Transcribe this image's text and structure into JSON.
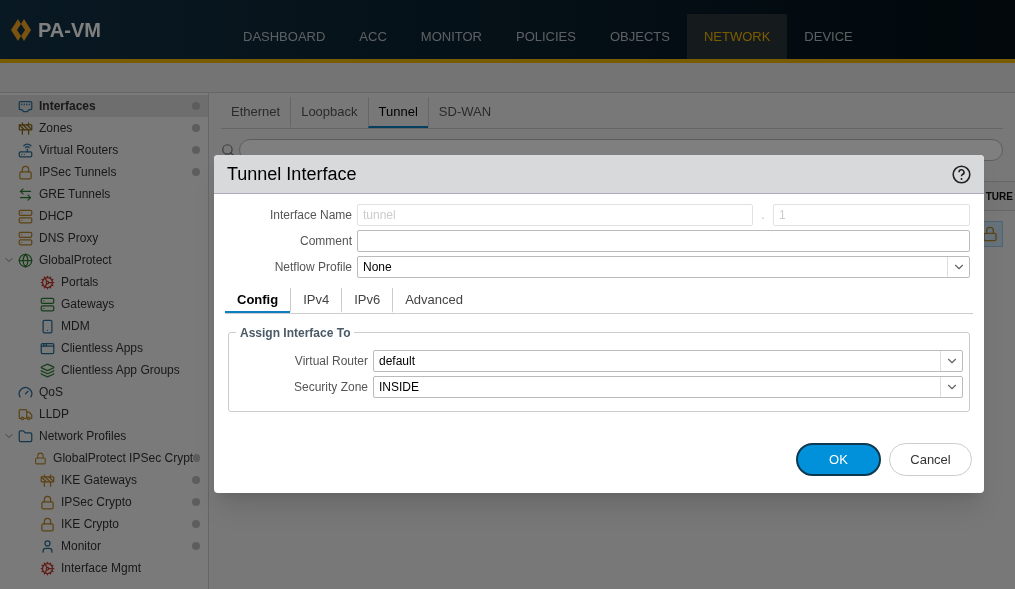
{
  "app": {
    "logo_text": "PA-VM"
  },
  "nav": [
    {
      "label": "DASHBOARD",
      "selected": false
    },
    {
      "label": "ACC",
      "selected": false
    },
    {
      "label": "MONITOR",
      "selected": false
    },
    {
      "label": "POLICIES",
      "selected": false
    },
    {
      "label": "OBJECTS",
      "selected": false
    },
    {
      "label": "NETWORK",
      "selected": true
    },
    {
      "label": "DEVICE",
      "selected": false
    }
  ],
  "sidebar": {
    "items": [
      {
        "label": "Interfaces",
        "selected": true,
        "dot": true
      },
      {
        "label": "Zones",
        "selected": false,
        "dot": true
      },
      {
        "label": "Virtual Routers",
        "selected": false,
        "dot": true
      },
      {
        "label": "IPSec Tunnels",
        "selected": false,
        "dot": true
      },
      {
        "label": "GRE Tunnels",
        "selected": false,
        "dot": false
      },
      {
        "label": "DHCP",
        "selected": false,
        "dot": false
      },
      {
        "label": "DNS Proxy",
        "selected": false,
        "dot": false
      },
      {
        "label": "GlobalProtect",
        "selected": false,
        "dot": false,
        "expanded": true,
        "children": [
          {
            "label": "Portals",
            "selected": false,
            "dot": false
          },
          {
            "label": "Gateways",
            "selected": false,
            "dot": false
          },
          {
            "label": "MDM",
            "selected": false,
            "dot": false
          },
          {
            "label": "Clientless Apps",
            "selected": false,
            "dot": false
          },
          {
            "label": "Clientless App Groups",
            "selected": false,
            "dot": false
          }
        ]
      },
      {
        "label": "QoS",
        "selected": false,
        "dot": false
      },
      {
        "label": "LLDP",
        "selected": false,
        "dot": false
      },
      {
        "label": "Network Profiles",
        "selected": false,
        "dot": false,
        "expanded": true,
        "children": [
          {
            "label": "GlobalProtect IPSec Crypt",
            "selected": false,
            "dot": true
          },
          {
            "label": "IKE Gateways",
            "selected": false,
            "dot": true
          },
          {
            "label": "IPSec Crypto",
            "selected": false,
            "dot": true
          },
          {
            "label": "IKE Crypto",
            "selected": false,
            "dot": true
          },
          {
            "label": "Monitor",
            "selected": false,
            "dot": true
          },
          {
            "label": "Interface Mgmt",
            "selected": false,
            "dot": false
          }
        ]
      }
    ]
  },
  "tabs": [
    {
      "label": "Ethernet",
      "selected": false
    },
    {
      "label": "Loopback",
      "selected": false
    },
    {
      "label": "Tunnel",
      "selected": true
    },
    {
      "label": "SD-WAN",
      "selected": false
    }
  ],
  "table": {
    "column_header": "TURE"
  },
  "dialog": {
    "title": "Tunnel Interface",
    "interface_name": {
      "label": "Interface Name",
      "value": "tunnel",
      "separator": ".",
      "suffix": "1",
      "disabled": true
    },
    "comment": {
      "label": "Comment"
    },
    "netflow_profile": {
      "label": "Netflow Profile",
      "value": "None"
    },
    "tabs": [
      {
        "label": "Config",
        "selected": true
      },
      {
        "label": "IPv4",
        "selected": false
      },
      {
        "label": "IPv6",
        "selected": false
      },
      {
        "label": "Advanced",
        "selected": false
      }
    ],
    "group": {
      "title": "Assign Interface To",
      "fields": [
        {
          "label": "Virtual Router",
          "value": "default"
        },
        {
          "label": "Security Zone",
          "value": "INSIDE"
        }
      ]
    },
    "buttons": [
      {
        "label": "OK",
        "kind": "primary"
      },
      {
        "label": "Cancel",
        "kind": "secondary"
      }
    ]
  }
}
